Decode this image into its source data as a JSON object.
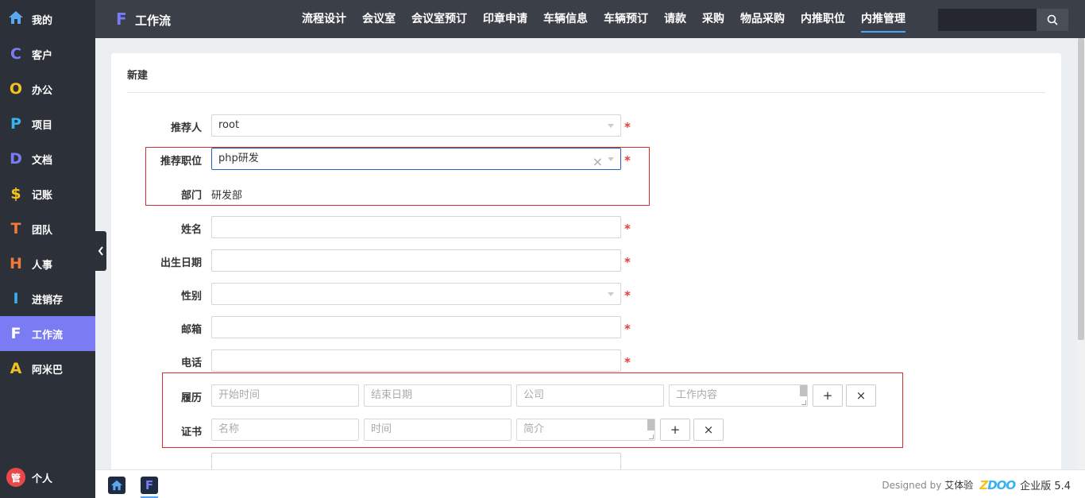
{
  "sidebar": {
    "items": [
      {
        "letter": "",
        "label": "我的",
        "color": "#5aa9f0"
      },
      {
        "letter": "C",
        "label": "客户",
        "color": "#7b7bf4"
      },
      {
        "letter": "O",
        "label": "办公",
        "color": "#f3c21b"
      },
      {
        "letter": "P",
        "label": "项目",
        "color": "#36b2f0"
      },
      {
        "letter": "D",
        "label": "文档",
        "color": "#7b7bf4"
      },
      {
        "letter": "$",
        "label": "记账",
        "color": "#f3c21b"
      },
      {
        "letter": "T",
        "label": "团队",
        "color": "#f07a3a"
      },
      {
        "letter": "H",
        "label": "人事",
        "color": "#f07a3a"
      },
      {
        "letter": "I",
        "label": "进销存",
        "color": "#36b2f0"
      },
      {
        "letter": "F",
        "label": "工作流",
        "color": "#ffffff"
      },
      {
        "letter": "A",
        "label": "阿米巴",
        "color": "#f3c21b"
      }
    ],
    "user": {
      "avatar": "管",
      "label": "个人"
    }
  },
  "topbar": {
    "logo_letter": "F",
    "app_name": "工作流",
    "nav": [
      "流程设计",
      "会议室",
      "会议室预订",
      "印章申请",
      "车辆信息",
      "车辆预订",
      "请款",
      "采购",
      "物品采购",
      "内推职位",
      "内推管理"
    ],
    "active_nav": "内推管理",
    "search_placeholder": ""
  },
  "form": {
    "title": "新建",
    "referrer": {
      "label": "推荐人",
      "value": "root"
    },
    "position": {
      "label": "推荐职位",
      "value": "php研发"
    },
    "department": {
      "label": "部门",
      "value": "研发部"
    },
    "name": {
      "label": "姓名",
      "value": ""
    },
    "birthday": {
      "label": "出生日期",
      "value": ""
    },
    "gender": {
      "label": "性别",
      "value": ""
    },
    "email": {
      "label": "邮箱",
      "value": ""
    },
    "phone": {
      "label": "电话",
      "value": ""
    },
    "resume": {
      "label": "履历",
      "start_placeholder": "开始时间",
      "end_placeholder": "结束日期",
      "company_placeholder": "公司",
      "content_placeholder": "工作内容"
    },
    "certificate": {
      "label": "证书",
      "name_placeholder": "名称",
      "time_placeholder": "时间",
      "intro_placeholder": "简介"
    },
    "required_mark": "*",
    "add_symbol": "+",
    "remove_symbol": "×"
  },
  "footer": {
    "designed_by": "Designed by",
    "brand": "艾体验",
    "product": "ZDOO",
    "edition": "企业版 5.4",
    "app_icon_letter": "F"
  },
  "colors": {
    "accent": "#7b7bf4",
    "required": "#e43d3d",
    "highlight_box": "#d92d2d"
  }
}
